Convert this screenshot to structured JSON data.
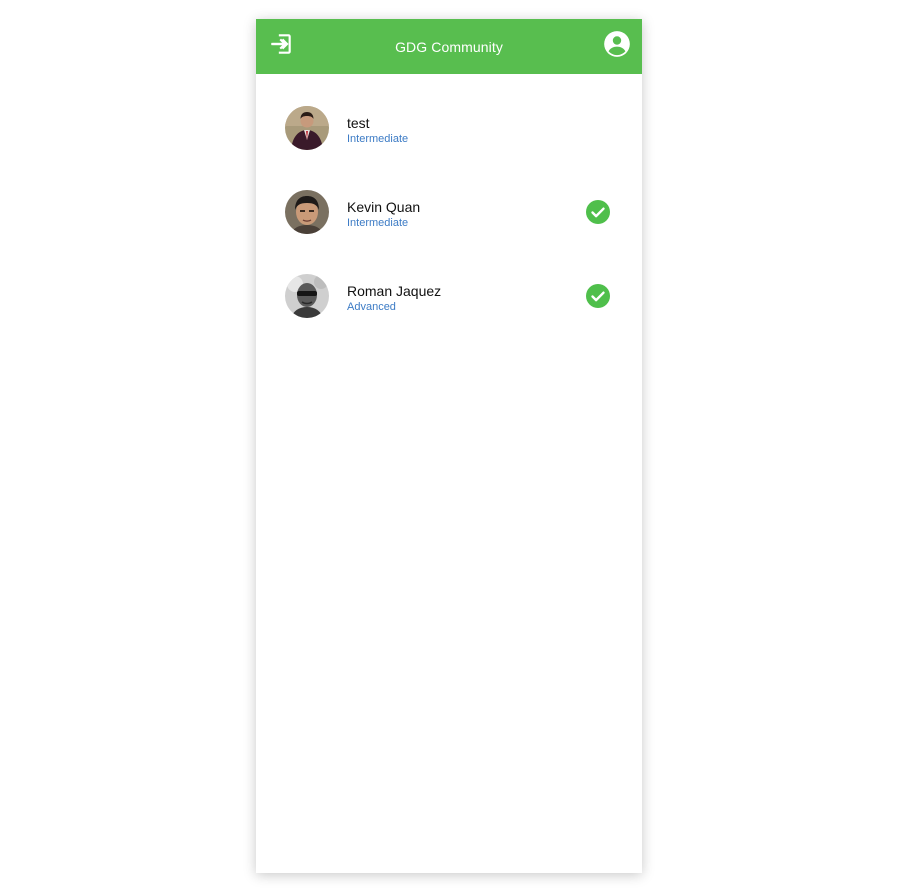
{
  "appbar": {
    "title": "GDG Community",
    "left_icon": "login-icon",
    "right_icon": "account-circle-icon",
    "color": "#58be4f"
  },
  "members": [
    {
      "name": "test",
      "level": "Intermediate",
      "avatar": "avatar-photo-suit",
      "checked": false
    },
    {
      "name": "Kevin Quan",
      "level": "Intermediate",
      "avatar": "avatar-photo-portrait",
      "checked": true
    },
    {
      "name": "Roman Jaquez",
      "level": "Advanced",
      "avatar": "avatar-photo-sunglasses",
      "checked": true
    }
  ],
  "colors": {
    "accent": "#58be4f",
    "level_text": "#3c7bc5",
    "check": "#4fbf4b"
  }
}
